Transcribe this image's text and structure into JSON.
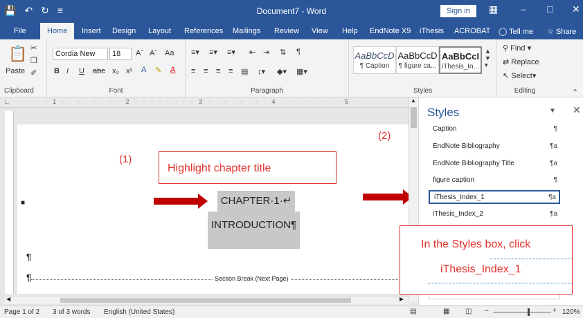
{
  "titlebar": {
    "title": "Document7 - Word",
    "signin": "Sign in",
    "save_icon": "save-icon",
    "undo_icon": "undo-icon",
    "redo_icon": "redo-icon"
  },
  "tabs": [
    "File",
    "Home",
    "Insert",
    "Design",
    "Layout",
    "References",
    "Mailings",
    "Review",
    "View",
    "Help",
    "EndNote X9",
    "iThesis",
    "ACROBAT",
    "Tell me",
    "Share"
  ],
  "active_tab": "Home",
  "ribbon": {
    "clipboard": {
      "label": "Clipboard",
      "paste": "Paste"
    },
    "font": {
      "label": "Font",
      "name": "Cordia New",
      "size": "18",
      "bold": "B",
      "italic": "I",
      "underline": "U",
      "strike": "abc",
      "sub": "x₂",
      "sup": "x²"
    },
    "paragraph": {
      "label": "Paragraph"
    },
    "styles": {
      "label": "Styles",
      "items": [
        {
          "preview": "AaBbCcD",
          "name": "¶ Caption"
        },
        {
          "preview": "AaBbCcD",
          "name": "¶ figure ca..."
        },
        {
          "preview": "AaBbCcI",
          "name": "iThesis_In..."
        }
      ]
    },
    "editing": {
      "label": "Editing",
      "find": "Find",
      "replace": "Replace",
      "select": "Select"
    }
  },
  "document": {
    "annotation1": "(1)",
    "annotation2": "(2)",
    "callout1": "Highlight chapter title",
    "chapter": "CHAPTER·1·↵",
    "introduction": "INTRODUCTION¶",
    "pilcrow": "¶",
    "section_break": "Section Break (Next Page)"
  },
  "styles_panel": {
    "title": "Styles",
    "items": [
      {
        "name": "Caption",
        "mark": "¶"
      },
      {
        "name": "EndNote Bibliography",
        "mark": "¶a"
      },
      {
        "name": "EndNote Bibliography Title",
        "mark": "¶a"
      },
      {
        "name": "figure caption",
        "mark": "¶"
      },
      {
        "name": "iThesis_Index_1",
        "mark": "¶a"
      },
      {
        "name": "iThesis_Index_2",
        "mark": "¶a"
      }
    ],
    "callout_line1": "In the Styles box, click",
    "callout_line2": "iThesis_Index_1"
  },
  "statusbar": {
    "page": "Page 1 of 2",
    "words": "3 of 3 words",
    "language": "English (United States)",
    "zoom": "120%"
  },
  "colors": {
    "accent": "#2b579a",
    "annotation": "#e0312b",
    "arrow": "#c00000"
  }
}
